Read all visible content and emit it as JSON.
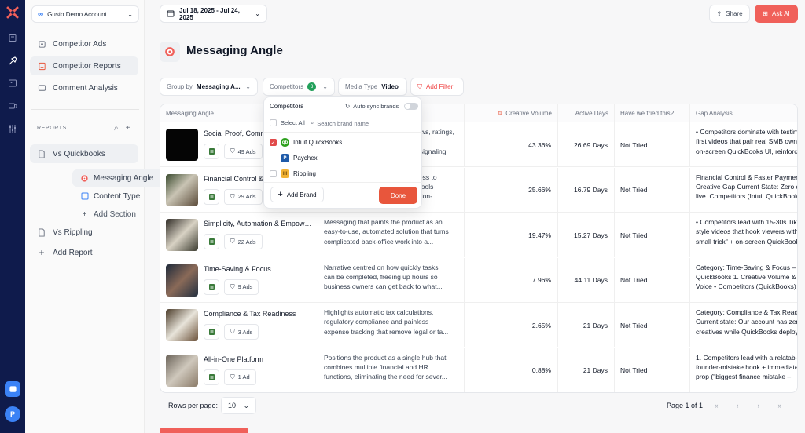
{
  "account": {
    "name": "Gusto Demo Account"
  },
  "nav": [
    {
      "label": "Competitor Ads"
    },
    {
      "label": "Competitor Reports"
    },
    {
      "label": "Comment Analysis"
    }
  ],
  "reports": {
    "section_label": "REPORTS",
    "items": [
      {
        "label": "Vs Quickbooks"
      },
      {
        "label": "Messaging Angle"
      },
      {
        "label": "Content Type"
      },
      {
        "label": "Add Section"
      },
      {
        "label": "Vs Rippling"
      },
      {
        "label": "Add Report"
      }
    ]
  },
  "header": {
    "date_range": "Jul 18, 2025 - Jul 24, 2025",
    "share_label": "Share",
    "ask_ai_label": "Ask AI",
    "title": "Messaging Angle"
  },
  "filters": {
    "group_by_label": "Group by",
    "group_by_value": "Messaging A...",
    "competitors_label": "Competitors",
    "competitors_count": "3",
    "media_type_label": "Media Type",
    "media_type_value": "Video",
    "add_filter_label": "Add Filter"
  },
  "table": {
    "columns": [
      "Messaging Angle",
      "",
      "Creative Volume",
      "Active Days",
      "Have we tried this?",
      "Gap Analysis"
    ],
    "rows": [
      {
        "name": "Social Proof, Community & Trust",
        "ads": "49 Ads",
        "desc": [
          "Messaging that showcases reviews, ratings,",
          "testimonials from small-business",
          "owners and app-hosted forums, signaling real..."
        ],
        "volume": "43.36%",
        "days": "26.69 Days",
        "tried": "Not Tried",
        "gap": [
          "• Competitors dominate with testimonial-",
          "first videos that pair real SMB owners with",
          "on-screen QuickBooks UI, reinforced by"
        ]
      },
      {
        "name": "Financial Control & Faster Payments",
        "ads": "29 Ads",
        "desc": [
          "Messaging that emphasizes access to",
          "real-time cash-flow insights and tools",
          "to get paid faster, for better decision-..."
        ],
        "volume": "25.66%",
        "days": "16.79 Days",
        "tried": "Not Tried",
        "gap": [
          "Financial Control & Faster Payments –",
          "Creative Gap Current State: Zero creatives",
          "live. Competitors (Intuit QuickBooks) run"
        ]
      },
      {
        "name": "Simplicity, Automation & Empowerment",
        "ads": "22 Ads",
        "desc": [
          "Messaging that paints the product as an",
          "easy-to-use, automated solution that turns",
          "complicated back-office work into a..."
        ],
        "volume": "19.47%",
        "days": "15.27 Days",
        "tried": "Not Tried",
        "gap": [
          "• Competitors lead with 15-30s TikTok-",
          "style videos that hook viewers with \"one",
          "small trick\" + on-screen QuickBooks UI"
        ]
      },
      {
        "name": "Time-Saving & Focus",
        "ads": "9 Ads",
        "desc": [
          "Narrative centred on how quickly tasks",
          "can be completed, freeing up hours so",
          "business owners can get back to what..."
        ],
        "volume": "7.96%",
        "days": "44.11 Days",
        "tried": "Not Tried",
        "gap": [
          "Category: Time-Saving & Focus – Intuit",
          "QuickBooks 1. Creative Volume & Share of",
          "Voice • Competitors (QuickBooks) own"
        ]
      },
      {
        "name": "Compliance & Tax Readiness",
        "ads": "3 Ads",
        "desc": [
          "Highlights automatic tax calculations,",
          "regulatory compliance and painless",
          "expense tracking that remove legal or ta..."
        ],
        "volume": "2.65%",
        "days": "21 Days",
        "tried": "Not Tried",
        "gap": [
          "Category: Compliance & Tax Readiness",
          "Current state: Our account has zero",
          "creatives while QuickBooks deploys a"
        ]
      },
      {
        "name": "All-in-One Platform",
        "ads": "1 Ad",
        "desc": [
          "Positions the product as a single hub that",
          "combines multiple financial and HR",
          "functions, eliminating the need for sever..."
        ],
        "volume": "0.88%",
        "days": "21 Days",
        "tried": "Not Tried",
        "gap": [
          "1. Competitors lead with a relatable",
          "founder-mistake hook + immediate value",
          "prop (\"biggest finance mistake –"
        ]
      }
    ]
  },
  "pagination": {
    "rows_per_page_label": "Rows per page:",
    "rows_per_page_value": "10",
    "page_text": "Page 1 of 1"
  },
  "dropdown": {
    "title": "Competitors",
    "auto_sync_label": "Auto sync brands",
    "select_all_label": "Select All",
    "search_placeholder": "Search brand name",
    "brands": [
      {
        "name": "Intuit QuickBooks",
        "checked": true,
        "color": "#2ca01c"
      },
      {
        "name": "Paychex",
        "checked": false,
        "color": "#1e5aa8"
      },
      {
        "name": "Rippling",
        "checked": false,
        "color": "#f2b233"
      }
    ],
    "add_brand_label": "Add Brand",
    "done_label": "Done"
  },
  "colors": {
    "accent": "#f0605a",
    "rail": "#0f1b4c",
    "checkbox": "#e14a4a"
  }
}
